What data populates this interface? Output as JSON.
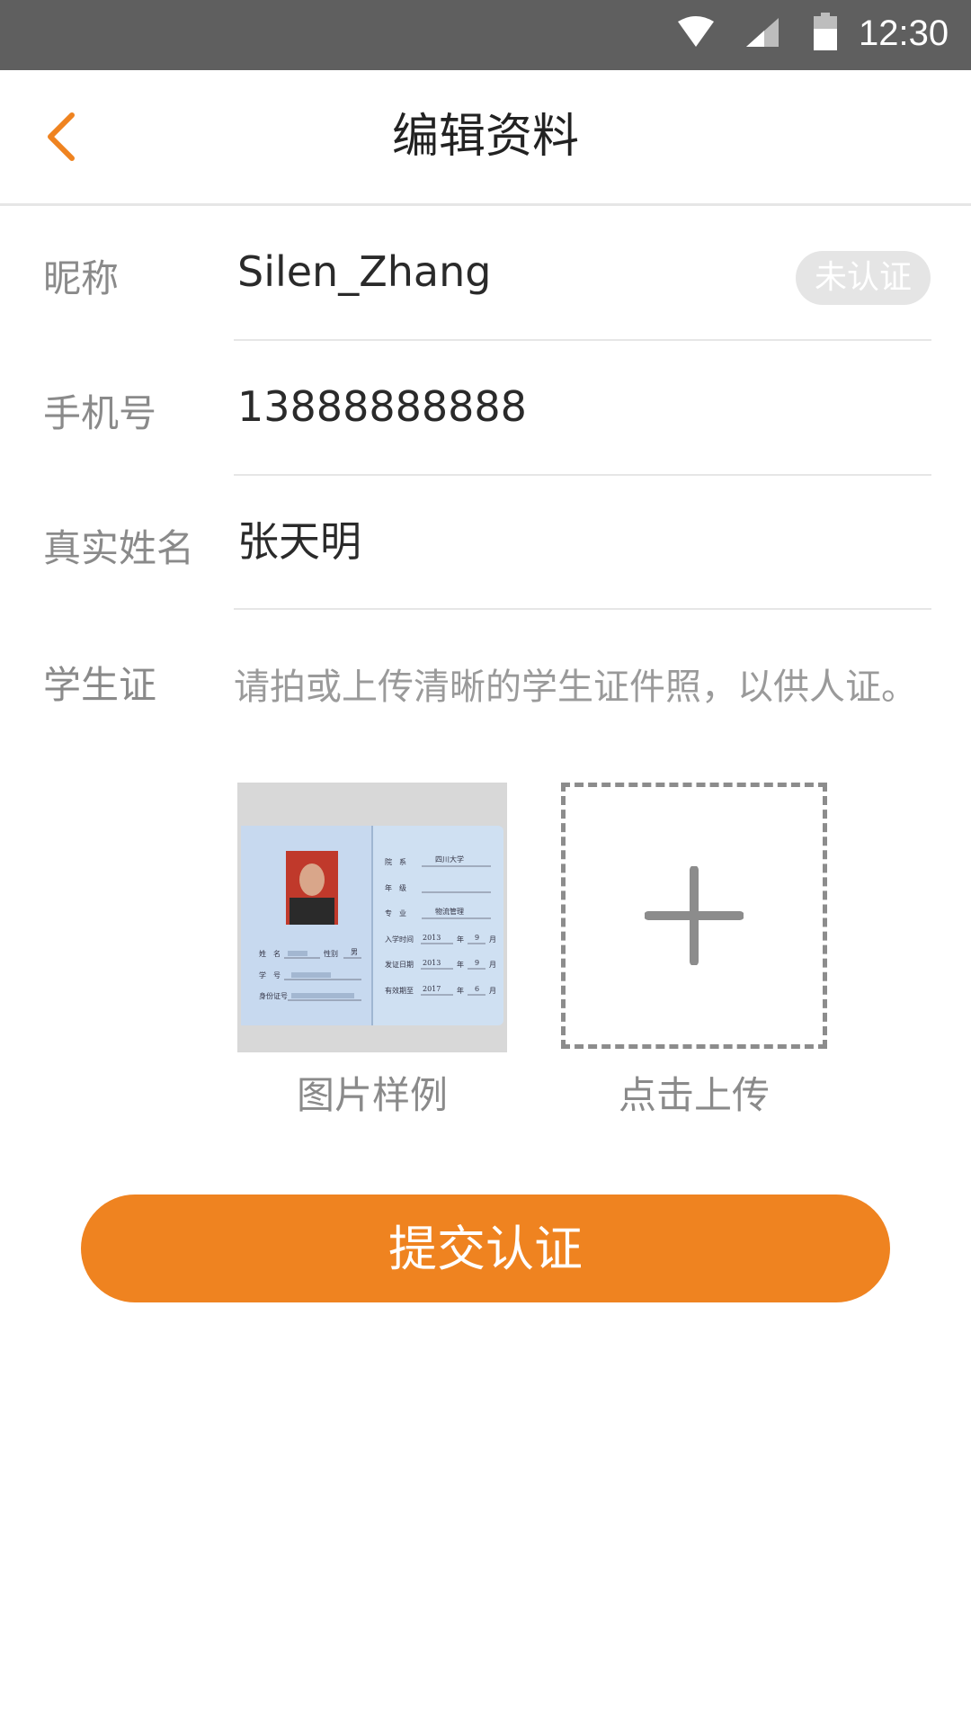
{
  "status_bar": {
    "time": "12:30",
    "icons": [
      "wifi-icon",
      "signal-icon",
      "battery-icon"
    ]
  },
  "header": {
    "title": "编辑资料",
    "back_icon": "chevron-left-icon"
  },
  "form": {
    "nickname": {
      "label": "昵称",
      "value": "Silen_Zhang",
      "badge": "未认证"
    },
    "phone": {
      "label": "手机号",
      "value": "13888888888"
    },
    "real_name": {
      "label": "真实姓名",
      "value": "张天明"
    },
    "student_id": {
      "label": "学生证",
      "hint": "请拍或上传清晰的学生证件照，以供人证。"
    }
  },
  "samples": {
    "example_caption": "图片样例",
    "upload_caption": "点击上传",
    "card_fields": {
      "faculty_label": "院　系",
      "faculty_value": "四川大学",
      "grade_label": "年　级",
      "major_label": "专　业",
      "major_value": "物流管理",
      "enroll_label": "入学时间",
      "enroll_year": "2013",
      "enroll_month": "9",
      "issue_label": "发证日期",
      "issue_year": "2013",
      "issue_month": "9",
      "valid_label": "有效期至",
      "valid_year": "2017",
      "valid_month": "6",
      "year_unit": "年",
      "month_unit": "月",
      "name_label": "姓　名",
      "gender_label": "性别",
      "gender_value": "男",
      "student_no_label": "学　号",
      "idcard_label": "身份证号"
    }
  },
  "actions": {
    "submit_label": "提交认证"
  },
  "colors": {
    "accent": "#ef8320",
    "statusbar": "#5f5f5f",
    "label": "#8a8a8a"
  }
}
